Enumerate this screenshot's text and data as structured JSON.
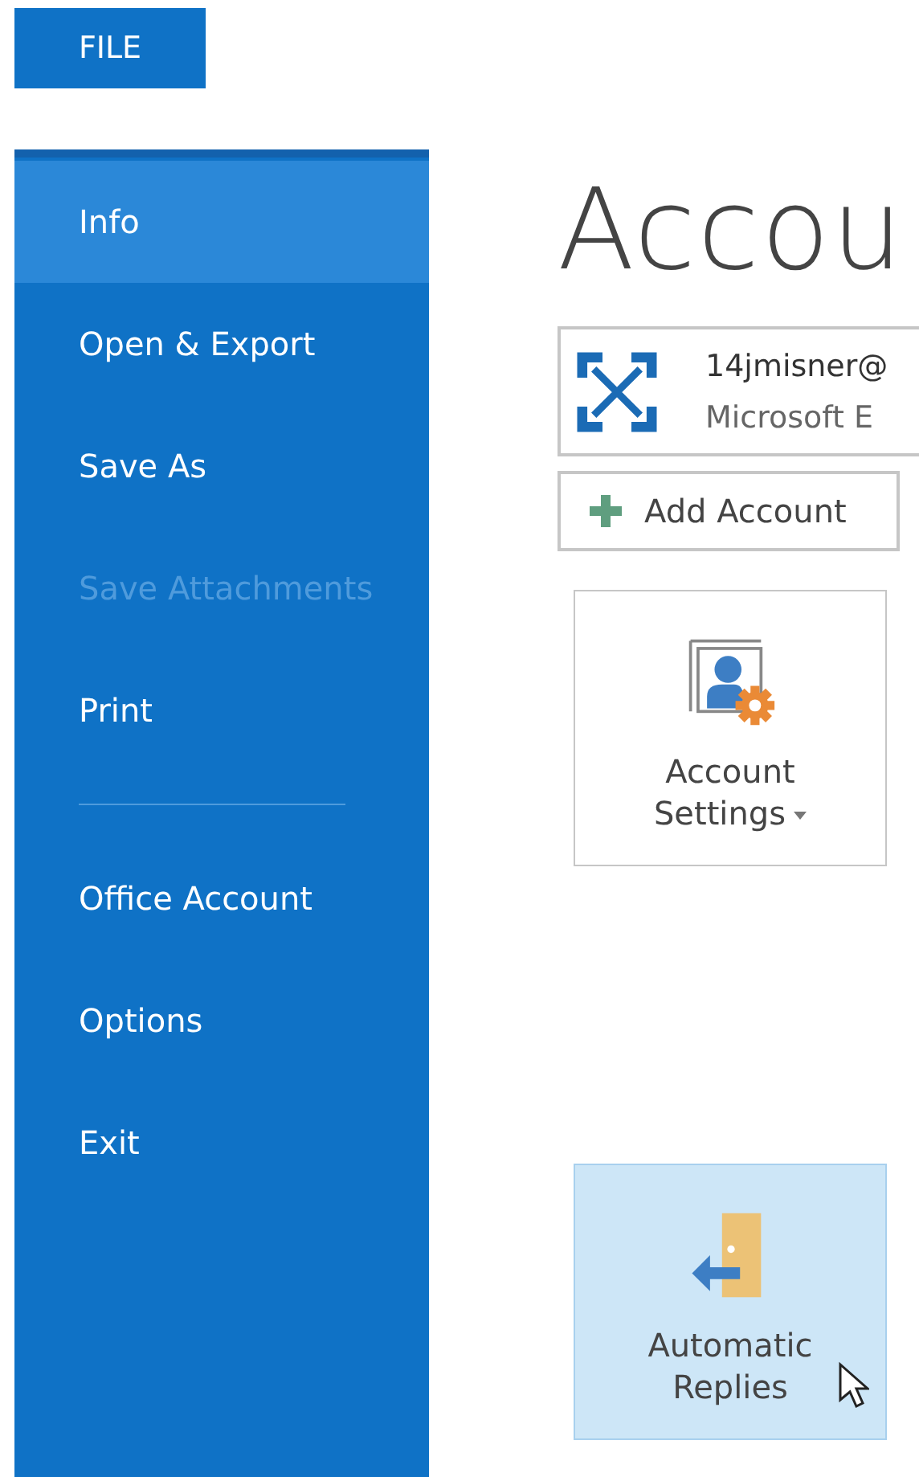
{
  "file_tab": {
    "label": "FILE"
  },
  "sidebar": {
    "items": [
      {
        "label": "Info",
        "selected": true,
        "disabled": false
      },
      {
        "label": "Open & Export",
        "selected": false,
        "disabled": false
      },
      {
        "label": "Save As",
        "selected": false,
        "disabled": false
      },
      {
        "label": "Save Attachments",
        "selected": false,
        "disabled": true
      },
      {
        "label": "Print",
        "selected": false,
        "disabled": false
      },
      {
        "kind": "separator"
      },
      {
        "label": "Office Account",
        "selected": false,
        "disabled": false
      },
      {
        "label": "Options",
        "selected": false,
        "disabled": false
      },
      {
        "label": "Exit",
        "selected": false,
        "disabled": false
      }
    ]
  },
  "heading": "Accou",
  "account": {
    "email": "14jmisner@",
    "type": "Microsoft E"
  },
  "add_account": {
    "label": "Add Account"
  },
  "tiles": [
    {
      "kind": "settings",
      "lines": [
        "Account",
        "Settings"
      ],
      "dropdown": true,
      "hovered": false
    },
    {
      "kind": "replies",
      "lines": [
        "Automatic",
        "Replies"
      ],
      "dropdown": false,
      "hovered": true
    }
  ]
}
